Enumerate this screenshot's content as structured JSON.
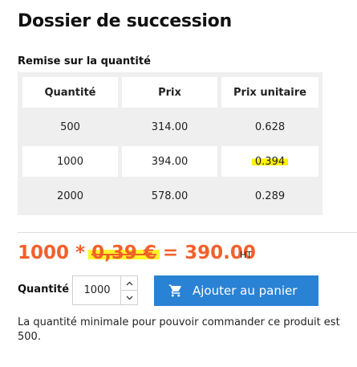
{
  "product": {
    "title": "Dossier de succession"
  },
  "discount": {
    "heading": "Remise sur la quantité",
    "columns": [
      "Quantité",
      "Prix",
      "Prix unitaire"
    ],
    "rows": [
      {
        "quantity": "500",
        "price": "314.00",
        "unit_price": "0.628"
      },
      {
        "quantity": "1000",
        "price": "394.00",
        "unit_price": "0.394"
      },
      {
        "quantity": "2000",
        "price": "578.00",
        "unit_price": "0.289"
      }
    ]
  },
  "pricing": {
    "qty": "1000",
    "times": "*",
    "old_price": "0,39 €",
    "equals": "=",
    "total": "390.00",
    "tax_label": "HT"
  },
  "order": {
    "quantity_label": "Quantité",
    "quantity_value": "1000",
    "add_to_cart_label": "Ajouter au panier"
  },
  "notice": {
    "minimum_text": "La quantité minimale pour pouvoir commander ce produit est 500."
  },
  "colors": {
    "accent_orange": "#f2602b",
    "button_blue": "#2a82d4",
    "highlight_yellow": "#fff200"
  }
}
